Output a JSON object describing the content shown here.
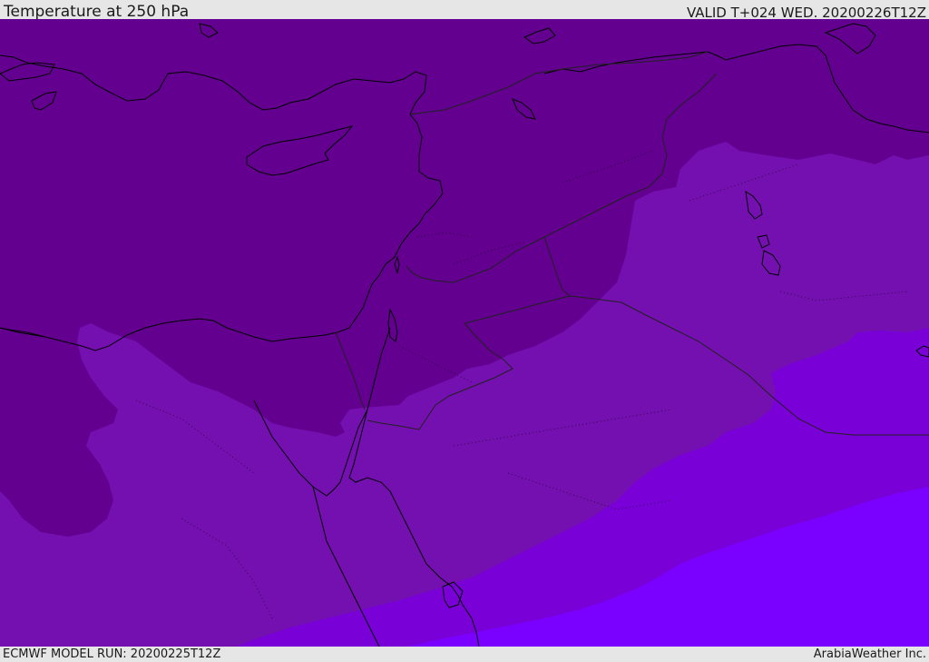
{
  "header": {
    "title": "Temperature at 250 hPa",
    "valid": "VALID T+024 WED. 20200226T12Z"
  },
  "footer": {
    "model_run": "ECMWF MODEL RUN: 20200225T12Z",
    "credit": "ArabiaWeather Inc."
  },
  "map": {
    "field": "Temperature",
    "level": "250 hPa",
    "region": "Eastern Mediterranean / Middle East",
    "colors": {
      "coldest": "#640090",
      "cold": "#7410b0",
      "mid": "#7a00d8",
      "warm": "#7a00ff",
      "coastline": "#000000",
      "border": "#202020"
    }
  }
}
